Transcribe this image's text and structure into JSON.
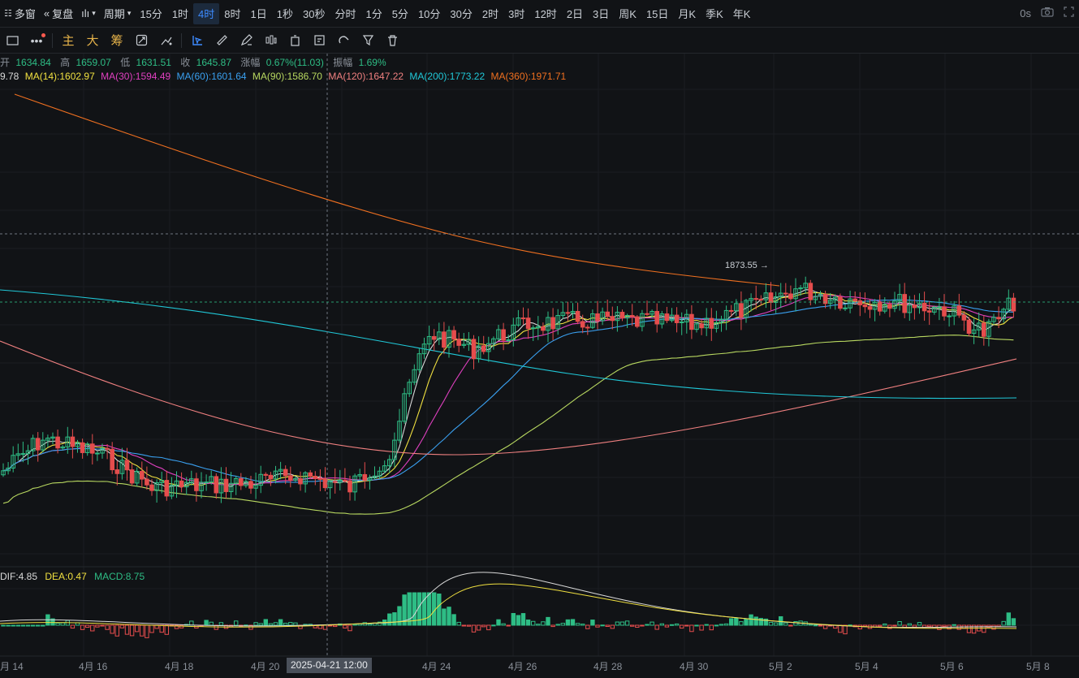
{
  "topbar": {
    "multi_window": "多窗",
    "restore": "复盘",
    "period_label": "周期",
    "timeframes": [
      "15分",
      "1时",
      "4时",
      "8时",
      "1日",
      "1秒",
      "30秒",
      "分时",
      "1分",
      "5分",
      "10分",
      "30分",
      "2时",
      "3时",
      "12时",
      "2日",
      "3日",
      "周K",
      "15日",
      "月K",
      "季K",
      "年K"
    ],
    "active_timeframe": "4时",
    "countdown": "0s"
  },
  "toolbar2": {
    "tags": [
      "主",
      "大",
      "筹"
    ]
  },
  "ohlc": {
    "open_label": "开",
    "open": "1634.84",
    "high_label": "高",
    "high": "1659.07",
    "low_label": "低",
    "low": "1631.51",
    "close_label": "收",
    "close": "1645.87",
    "change_label": "涨幅",
    "change": "0.67%(11.03)",
    "amp_label": "振幅",
    "amp": "1.69%"
  },
  "ma": {
    "ma7_partial": "9.78",
    "ma14": "MA(14):1602.97",
    "ma30": "MA(30):1594.49",
    "ma60": "MA(60):1601.64",
    "ma90": "MA(90):1586.70",
    "ma120": "MA(120):1647.22",
    "ma200": "MA(200):1773.22",
    "ma360": "MA(360):1971.71"
  },
  "macd": {
    "dif": "DIF:4.85",
    "dea": "DEA:0.47",
    "macd": "MACD:8.75"
  },
  "high_marker": "1873.55",
  "x_axis": [
    "月 14",
    "4月 16",
    "4月 18",
    "4月 20",
    "4月 24",
    "4月 26",
    "4月 28",
    "4月 30",
    "5月 2",
    "5月 4",
    "5月 6",
    "5月 8"
  ],
  "crosshair_date": "2025-04-21 12:00",
  "colors": {
    "bg": "#111316",
    "up": "#2ebd85",
    "down": "#e54d4d",
    "ma7": "#d9d9d9",
    "ma14": "#f0e040",
    "ma30": "#e040c0",
    "ma60": "#3aa0f0",
    "ma90": "#b8d860",
    "ma120": "#f08080",
    "ma200": "#20c8d8",
    "ma360": "#f07020"
  }
}
